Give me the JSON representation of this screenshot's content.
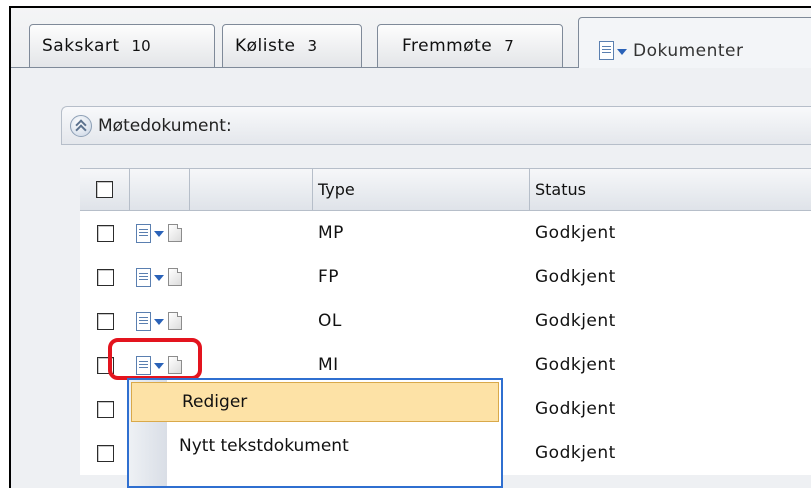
{
  "tabs": [
    {
      "label": "Sakskart",
      "count": "10"
    },
    {
      "label": "Køliste",
      "count": "3"
    },
    {
      "label": "Fremmøte",
      "count": "7"
    },
    {
      "label": "Dokumenter",
      "count": ""
    }
  ],
  "section": {
    "title": "Møtedokument:"
  },
  "table": {
    "headers": {
      "type": "Type",
      "status": "Status"
    },
    "rows": [
      {
        "type": "MP",
        "status": "Godkjent"
      },
      {
        "type": "FP",
        "status": "Godkjent"
      },
      {
        "type": "OL",
        "status": "Godkjent"
      },
      {
        "type": "MI",
        "status": "Godkjent"
      },
      {
        "type": "",
        "status": "Godkjent"
      },
      {
        "type": "",
        "status": "Godkjent"
      }
    ]
  },
  "context_menu": {
    "items": [
      "Rediger",
      "Nytt tekstdokument"
    ]
  },
  "colors": {
    "highlight_ring": "#e3141e",
    "menu_border": "#2f6fd0",
    "menu_selected": "#fde2a6"
  }
}
